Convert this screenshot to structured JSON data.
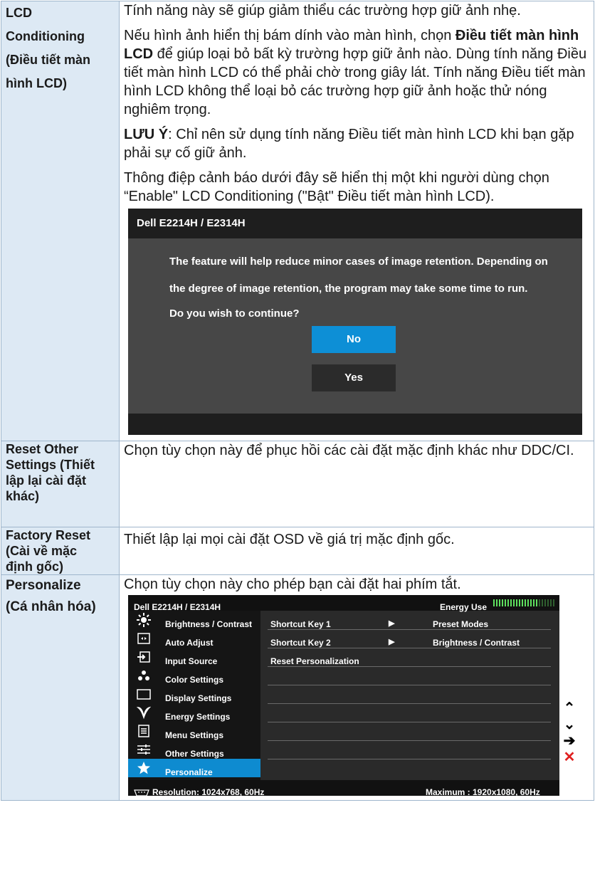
{
  "rows": {
    "lcd": {
      "label_lines": [
        "LCD",
        "Conditioning",
        "(Điều tiết màn",
        "hình LCD)"
      ],
      "p1": "Tính năng này sẽ giúp giảm thiểu các trường hợp giữ ảnh nhẹ.",
      "p2_pre": "Nếu hình ảnh hiển thị bám dính vào màn hình, chọn ",
      "p2_bold": "Điều tiết màn hình LCD",
      "p2_post": " để giúp loại bỏ bất kỳ trường hợp giữ ảnh nào. Dùng tính năng Điều tiết màn hình LCD có thể phải chờ trong giây lát. Tính năng Điều tiết màn hình LCD không thể loại bỏ các trường hợp giữ ảnh hoặc thử nóng nghiêm trọng.",
      "note_bold": "LƯU Ý",
      "note_text": ": Chỉ nên sử dụng tính năng Điều tiết màn hình LCD khi bạn gặp phải sự cố giữ ảnh.",
      "p4": "Thông điệp cảnh báo dưới đây sẽ hiển thị một khi người dùng chọn “Enable\" LCD Conditioning (\"Bật\" Điều tiết màn hình LCD)."
    },
    "reset_other": {
      "label_lines": [
        "Reset Other",
        "Settings (Thiết",
        "lập lại cài đặt",
        "khác)"
      ],
      "text": "Chọn tùy chọn này để phục hồi các cài đặt mặc định khác như DDC/CI."
    },
    "factory": {
      "label_lines": [
        "Factory Reset",
        "(Cài về mặc",
        "định gốc)"
      ],
      "text": "Thiết lập lại mọi cài đặt OSD về giá trị mặc định gốc."
    },
    "personalize": {
      "label_lines": [
        "Personalize",
        "(Cá nhân hóa)"
      ],
      "text": "Chọn tùy chọn này cho phép bạn cài đặt hai phím tắt."
    }
  },
  "dialog": {
    "title": "Dell E2214H / E2314H",
    "line1": "The feature will help reduce minor cases of image retention. Depending on",
    "line2": "the degree of image retention, the program may take some time to run.",
    "line3": "Do you wish to continue?",
    "no": "No",
    "yes": "Yes",
    "no_color": "#0d8fd6"
  },
  "osd": {
    "title": "Dell E2214H / E2314H",
    "energy_label": "Energy Use",
    "menu": [
      {
        "label": "Brightness / Contrast",
        "icon": "sun-icon"
      },
      {
        "label": "Auto Adjust",
        "icon": "auto-adjust-icon"
      },
      {
        "label": "Input Source",
        "icon": "input-source-icon"
      },
      {
        "label": "Color Settings",
        "icon": "color-dots-icon"
      },
      {
        "label": "Display Settings",
        "icon": "display-icon"
      },
      {
        "label": "Energy Settings",
        "icon": "leaf-icon"
      },
      {
        "label": "Menu Settings",
        "icon": "menu-icon"
      },
      {
        "label": "Other Settings",
        "icon": "sliders-icon"
      },
      {
        "label": "Personalize",
        "icon": "star-icon"
      }
    ],
    "options": [
      {
        "key": "Shortcut Key 1",
        "value": "Preset Modes"
      },
      {
        "key": "Shortcut Key 2",
        "value": "Brightness / Contrast"
      },
      {
        "key": "Reset Personalization",
        "value": ""
      }
    ],
    "resolution": "Resolution: 1024x768,  60Hz",
    "maximum": "Maximum : 1920x1080,  60Hz",
    "accent": "#0e8bd0"
  }
}
